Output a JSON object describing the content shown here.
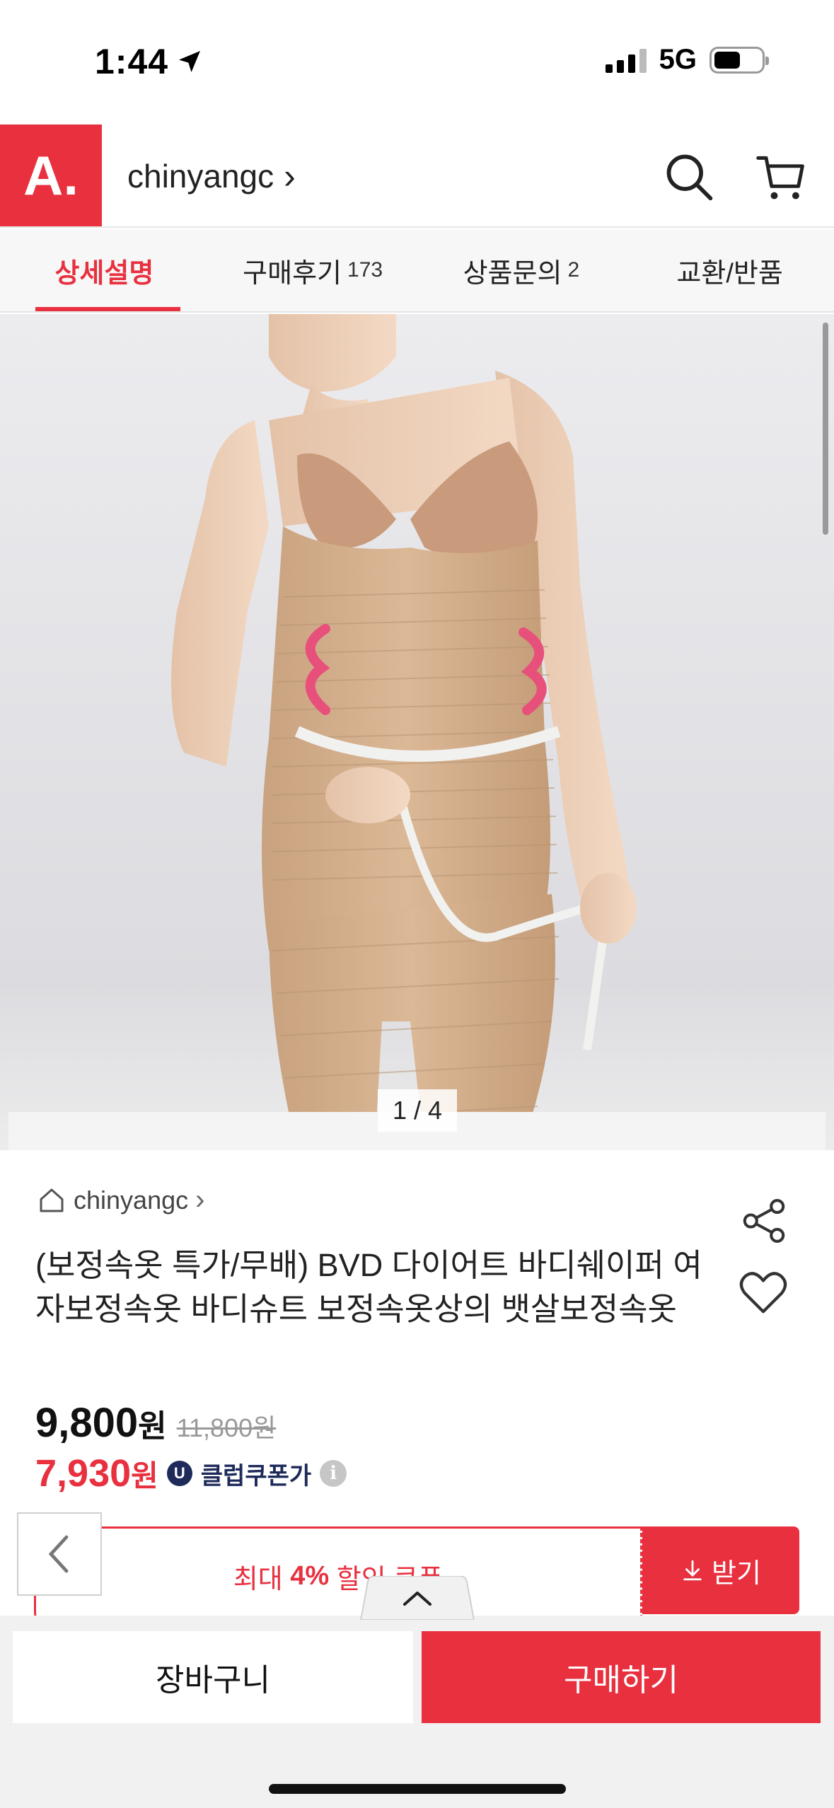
{
  "status_bar": {
    "time": "1:44",
    "network": "5G"
  },
  "header": {
    "logo": "A.",
    "store_name": "chinyangc",
    "chevron": "›"
  },
  "tabs": [
    {
      "label": "상세설명",
      "count": "",
      "active": true
    },
    {
      "label": "구매후기",
      "count": "173",
      "active": false
    },
    {
      "label": "상품문의",
      "count": "2",
      "active": false
    },
    {
      "label": "교환/반품",
      "count": "",
      "active": false
    }
  ],
  "gallery": {
    "pager": "1 / 4"
  },
  "product": {
    "store": "chinyangc",
    "store_chevron": "›",
    "title": "(보정속옷 특가/무배) BVD 다이어트 바디쉐이퍼 여자보정속옷 바디슈트 보정속옷상의 뱃살보정속옷",
    "price": "9,800",
    "price_unit": "원",
    "original_price": "11,800원",
    "coupon_price": "7,930",
    "coupon_price_unit": "원",
    "club_badge": "U",
    "club_label": "클럽쿠폰가",
    "info_icon": "i"
  },
  "coupon_banner": {
    "prefix": "최대 ",
    "highlight": "4%",
    "suffix": " 할인 쿠폰",
    "button_label": "받기"
  },
  "bottom_bar": {
    "cart_label": "장바구니",
    "buy_label": "구매하기"
  },
  "colors": {
    "brand": "#e8303f",
    "club": "#1e2a5a"
  }
}
